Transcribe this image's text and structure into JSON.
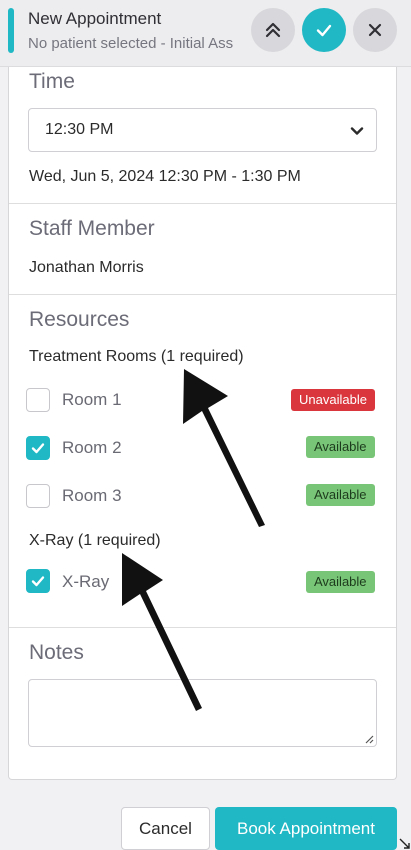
{
  "header": {
    "title": "New Appointment",
    "subtitle": "No patient selected - Initial Ass",
    "collapse_icon": "double-chevron-up-icon",
    "confirm_icon": "check-icon",
    "close_icon": "close-icon"
  },
  "time": {
    "heading": "Time",
    "selected_time": "12:30 PM",
    "range_text": "Wed, Jun 5, 2024 12:30 PM - 1:30 PM"
  },
  "staff": {
    "heading": "Staff Member",
    "name": "Jonathan Morris"
  },
  "resources": {
    "heading": "Resources",
    "groups": [
      {
        "label": "Treatment Rooms (1 required)",
        "items": [
          {
            "label": "Room 1",
            "checked": false,
            "status": "Unavailable"
          },
          {
            "label": "Room 2",
            "checked": true,
            "status": "Available"
          },
          {
            "label": "Room 3",
            "checked": false,
            "status": "Available"
          }
        ]
      },
      {
        "label": "X-Ray (1 required)",
        "items": [
          {
            "label": "X-Ray",
            "checked": true,
            "status": "Available"
          }
        ]
      }
    ]
  },
  "notes": {
    "heading": "Notes",
    "value": ""
  },
  "footer": {
    "cancel_label": "Cancel",
    "book_label": "Book Appointment"
  },
  "colors": {
    "accent": "#1fb8c4",
    "unavailable": "#d9373d",
    "available": "#79c577"
  }
}
